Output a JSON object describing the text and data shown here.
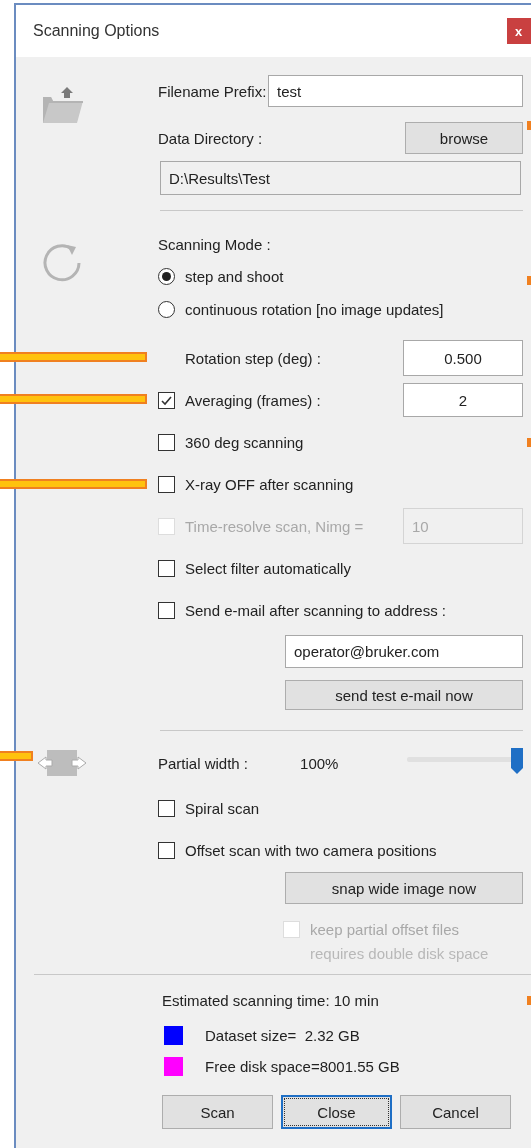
{
  "window": {
    "title": "Scanning Options",
    "close": "x"
  },
  "file": {
    "prefix_label": "Filename Prefix:",
    "prefix_value": "test",
    "directory_label": "Data Directory :",
    "browse": "browse",
    "directory_value": "D:\\Results\\Test"
  },
  "scanning": {
    "mode_label": "Scanning Mode :",
    "modes": [
      {
        "label": "step and shoot",
        "selected": true
      },
      {
        "label": "continuous rotation [no image updates]",
        "selected": false
      }
    ],
    "options": [
      {
        "kind": "field",
        "label": "Rotation step (deg) :",
        "value": "0.500",
        "disabled": false
      },
      {
        "kind": "checkfield",
        "label": "Averaging (frames) :",
        "checked": true,
        "value": "2",
        "disabled": false
      },
      {
        "kind": "check",
        "label": "360 deg scanning",
        "checked": false,
        "disabled": false
      },
      {
        "kind": "check",
        "label": "X-ray OFF after scanning",
        "checked": false,
        "disabled": false
      },
      {
        "kind": "checkfield",
        "label": "Time-resolve scan, Nimg =",
        "checked": false,
        "value": "10",
        "disabled": true
      },
      {
        "kind": "check",
        "label": "Select filter automatically",
        "checked": false,
        "disabled": false
      },
      {
        "kind": "check",
        "label": "Send e-mail after scanning to address :",
        "checked": false,
        "disabled": false
      }
    ],
    "email": "operator@bruker.com",
    "test_button": "send test e-mail now"
  },
  "partial": {
    "label": "Partial width :",
    "reading": "100%",
    "level": 1.0,
    "options": [
      {
        "label": "Spiral scan",
        "checked": false
      },
      {
        "label": "Offset scan with two camera positions",
        "checked": false
      }
    ],
    "snap_button": "snap wide image now",
    "keep": {
      "label": "keep partial offset files",
      "note": "requires double disk space",
      "checked": false,
      "disabled": true
    }
  },
  "summary": {
    "estimate": "Estimated scanning time: 10 min",
    "legend": [
      {
        "label": "Dataset size=  2.32 GB",
        "color": "#0000ff"
      },
      {
        "label": "Free disk space=8001.55 GB",
        "color": "#ff00ff"
      }
    ]
  },
  "buttons": [
    {
      "label": "Scan",
      "focused": false
    },
    {
      "label": "Close",
      "focused": true
    },
    {
      "label": "Cancel",
      "focused": false
    }
  ]
}
